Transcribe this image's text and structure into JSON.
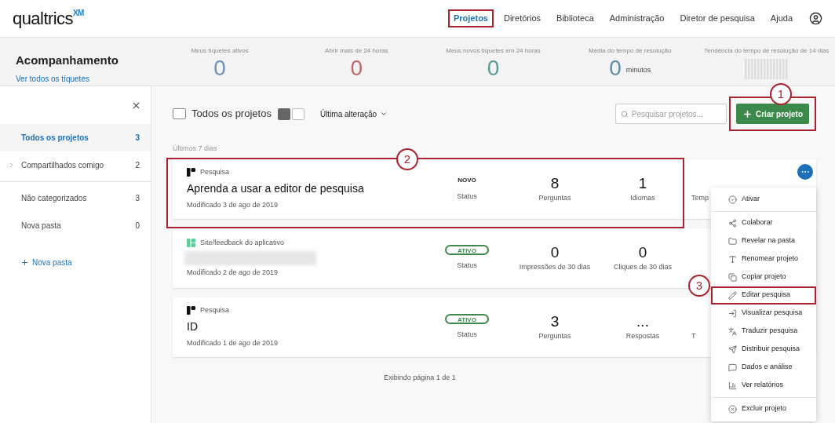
{
  "logo": {
    "name": "qualtrics",
    "sup": "XM"
  },
  "nav": [
    {
      "label": "Projetos",
      "selected": true,
      "highlighted": true
    },
    {
      "label": "Diretórios",
      "selected": false,
      "highlighted": false
    },
    {
      "label": "Biblioteca",
      "selected": false,
      "highlighted": false
    },
    {
      "label": "Administração",
      "selected": false,
      "highlighted": false
    },
    {
      "label": "Diretor de pesquisa",
      "selected": false,
      "highlighted": false
    },
    {
      "label": "Ajuda",
      "selected": false,
      "highlighted": false
    }
  ],
  "tracking": {
    "title": "Acompanhamento",
    "link": "Ver todos os tíquetes",
    "stats": [
      {
        "kind": "number",
        "label": "Meus tíquetes ativos",
        "value": "0",
        "color": "#6b93b8"
      },
      {
        "kind": "number",
        "label": "Abrir mais de 24 horas",
        "value": "0",
        "color": "#c0676a"
      },
      {
        "kind": "number",
        "label": "Meus novos tíquetes em 24 horas",
        "value": "0",
        "color": "#5e9a96"
      },
      {
        "kind": "number",
        "label": "Média do tempo de resolução",
        "value": "0",
        "unit": "minutos",
        "color": "#5d8fa8"
      },
      {
        "kind": "trend",
        "label": "Tendência do tempo de resolução de 14 dias"
      }
    ]
  },
  "sidebar": {
    "items": [
      {
        "label": "Todos os projetos",
        "count": "3",
        "selected": true,
        "expandable": false
      },
      {
        "label": "Compartilhados comigo",
        "count": "2",
        "selected": false,
        "expandable": true
      },
      {
        "label": "Não categorizados",
        "count": "3",
        "selected": false,
        "expandable": false
      },
      {
        "label": "Nova pasta",
        "count": "0",
        "selected": false,
        "expandable": false
      }
    ],
    "new_folder": "Nova pasta"
  },
  "toolbar": {
    "title": "Todos os projetos",
    "select_all_checked": false,
    "sort": "Última alteração",
    "search_placeholder": "Pesquisar projetos...",
    "create": "Criar projeto",
    "create_highlighted": true
  },
  "section_label": "Últimos 7 dias",
  "projects": [
    {
      "kind": "survey",
      "type_label": "Pesquisa",
      "name": "Aprenda a usar a editor de pesquisa",
      "modified": "Modificado 3 de ago de 2019",
      "highlighted": true,
      "menu_open": true,
      "status": {
        "kind": "plain",
        "text": "NOVO",
        "label": "Status"
      },
      "metrics": [
        {
          "value": "8",
          "label": "Perguntas"
        },
        {
          "value": "1",
          "label": "Idiomas"
        }
      ],
      "extra": "Temp"
    },
    {
      "kind": "site",
      "type_label": "Site/feedback do aplicativo",
      "modified": "Modificado 2 de ago de 2019",
      "highlighted": false,
      "menu_open": false,
      "status": {
        "kind": "pill",
        "text": "ATIVO",
        "label": "Status"
      },
      "metrics": [
        {
          "value": "0",
          "label": "Impressões de 30 dias"
        },
        {
          "value": "0",
          "label": "Cliques de 30 dias"
        }
      ]
    },
    {
      "kind": "survey",
      "type_label": "Pesquisa",
      "name": "ID",
      "modified": "Modificado 1 de ago de 2019",
      "highlighted": false,
      "menu_open": false,
      "status": {
        "kind": "pill",
        "text": "ATIVO",
        "label": "Status"
      },
      "metrics": [
        {
          "value": "3",
          "label": "Perguntas"
        },
        {
          "value": "...",
          "label": "Respostas"
        }
      ],
      "extra": "T"
    }
  ],
  "pagination": "Exibindo página 1 de 1",
  "menu": [
    {
      "label": "Ativar",
      "highlighted": false
    },
    {
      "label": "Colaborar",
      "highlighted": false
    },
    {
      "label": "Revelar na pasta",
      "highlighted": false
    },
    {
      "label": "Renomear projeto",
      "highlighted": false
    },
    {
      "label": "Copiar projeto",
      "highlighted": false
    },
    {
      "label": "Editar pesquisa",
      "highlighted": true
    },
    {
      "label": "Visualizar pesquisa",
      "highlighted": false
    },
    {
      "label": "Traduzir pesquisa",
      "highlighted": false
    },
    {
      "label": "Distribuir pesquisa",
      "highlighted": false
    },
    {
      "label": "Dados e análise",
      "highlighted": false
    },
    {
      "label": "Ver relatórios",
      "highlighted": false
    },
    {
      "label": "Excluir projeto",
      "highlighted": false
    }
  ],
  "callouts": [
    "1",
    "2",
    "3"
  ]
}
